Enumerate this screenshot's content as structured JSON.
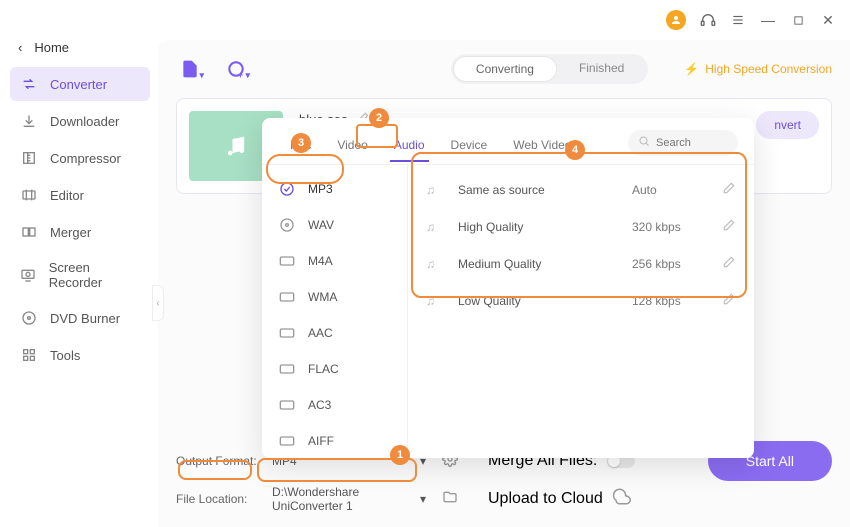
{
  "titlebar": {},
  "sidebar": {
    "home": "Home",
    "items": [
      {
        "label": "Converter"
      },
      {
        "label": "Downloader"
      },
      {
        "label": "Compressor"
      },
      {
        "label": "Editor"
      },
      {
        "label": "Merger"
      },
      {
        "label": "Screen Recorder"
      },
      {
        "label": "DVD Burner"
      },
      {
        "label": "Tools"
      }
    ]
  },
  "toolbar": {
    "seg_converting": "Converting",
    "seg_finished": "Finished",
    "high_speed": "High Speed Conversion"
  },
  "card": {
    "title": "blue sea",
    "convert": "nvert"
  },
  "popup": {
    "tabs": [
      "Rec",
      "Video",
      "Audio",
      "Device",
      "Web Video"
    ],
    "search_placeholder": "Search",
    "formats": [
      "MP3",
      "WAV",
      "M4A",
      "WMA",
      "AAC",
      "FLAC",
      "AC3",
      "AIFF"
    ],
    "qualities": [
      {
        "label": "Same as source",
        "rate": "Auto"
      },
      {
        "label": "High Quality",
        "rate": "320 kbps"
      },
      {
        "label": "Medium Quality",
        "rate": "256 kbps"
      },
      {
        "label": "Low Quality",
        "rate": "128 kbps"
      }
    ]
  },
  "footer": {
    "output_format_label": "Output Format:",
    "output_format_value": "MP4",
    "merge_label": "Merge All Files:",
    "file_location_label": "File Location:",
    "file_location_value": "D:\\Wondershare UniConverter 1",
    "upload_label": "Upload to Cloud",
    "start_all": "Start All"
  },
  "annotations": {
    "1": "1",
    "2": "2",
    "3": "3",
    "4": "4"
  }
}
